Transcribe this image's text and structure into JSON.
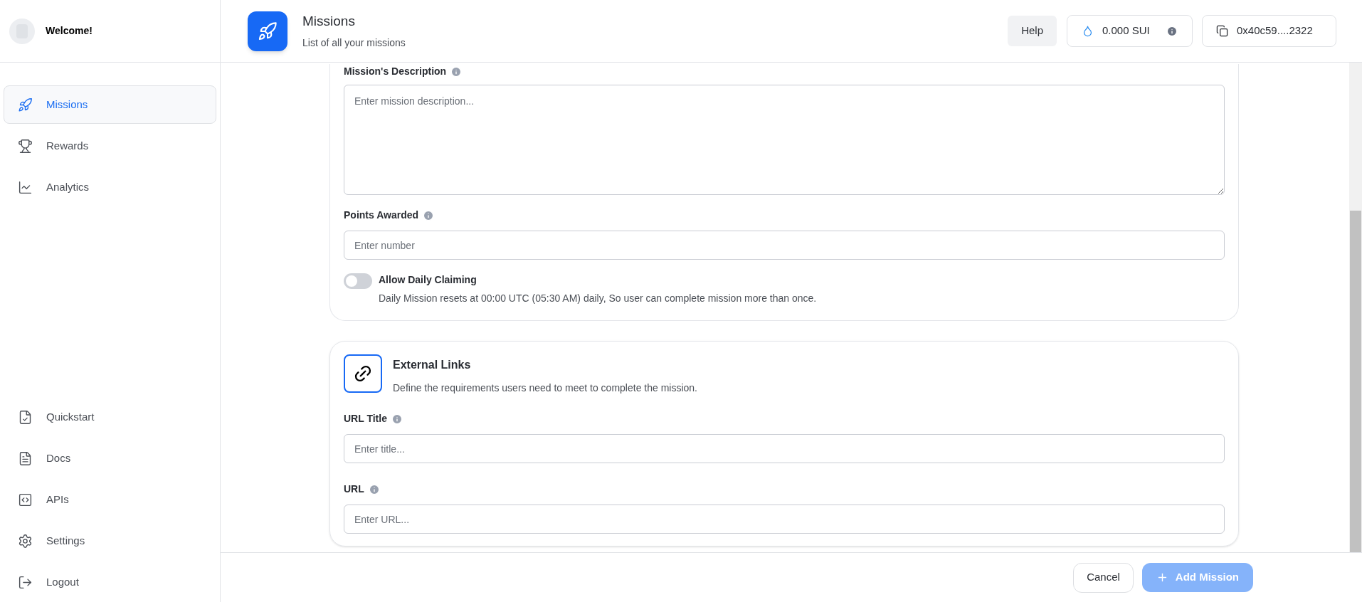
{
  "sidebar": {
    "welcome": "Welcome!",
    "items": [
      {
        "label": "Missions",
        "selected": true
      },
      {
        "label": "Rewards",
        "selected": false
      },
      {
        "label": "Analytics",
        "selected": false
      }
    ],
    "bottom_items": [
      {
        "label": "Quickstart"
      },
      {
        "label": "Docs"
      },
      {
        "label": "APIs"
      },
      {
        "label": "Settings"
      },
      {
        "label": "Logout"
      }
    ]
  },
  "header": {
    "title": "Missions",
    "subtitle": "List of all your missions",
    "help": "Help",
    "balance": "0.000 SUI",
    "address": "0x40c59....2322"
  },
  "details": {
    "description_label": "Mission's Description",
    "description_placeholder": "Enter mission description...",
    "points_label": "Points Awarded",
    "points_placeholder": "Enter number",
    "daily": {
      "label": "Allow Daily Claiming",
      "on": false,
      "hint": "Daily Mission resets at 00:00 UTC (05:30 AM) daily, So user can complete mission more than once."
    }
  },
  "links": {
    "title": "External Links",
    "subtitle": "Define the requirements users need to meet to complete the mission.",
    "fields": [
      {
        "label": "URL Title",
        "placeholder": "Enter title..."
      },
      {
        "label": "URL",
        "placeholder": "Enter URL..."
      }
    ]
  },
  "footer": {
    "cancel": "Cancel",
    "add": "Add Mission",
    "add_disabled": true
  }
}
